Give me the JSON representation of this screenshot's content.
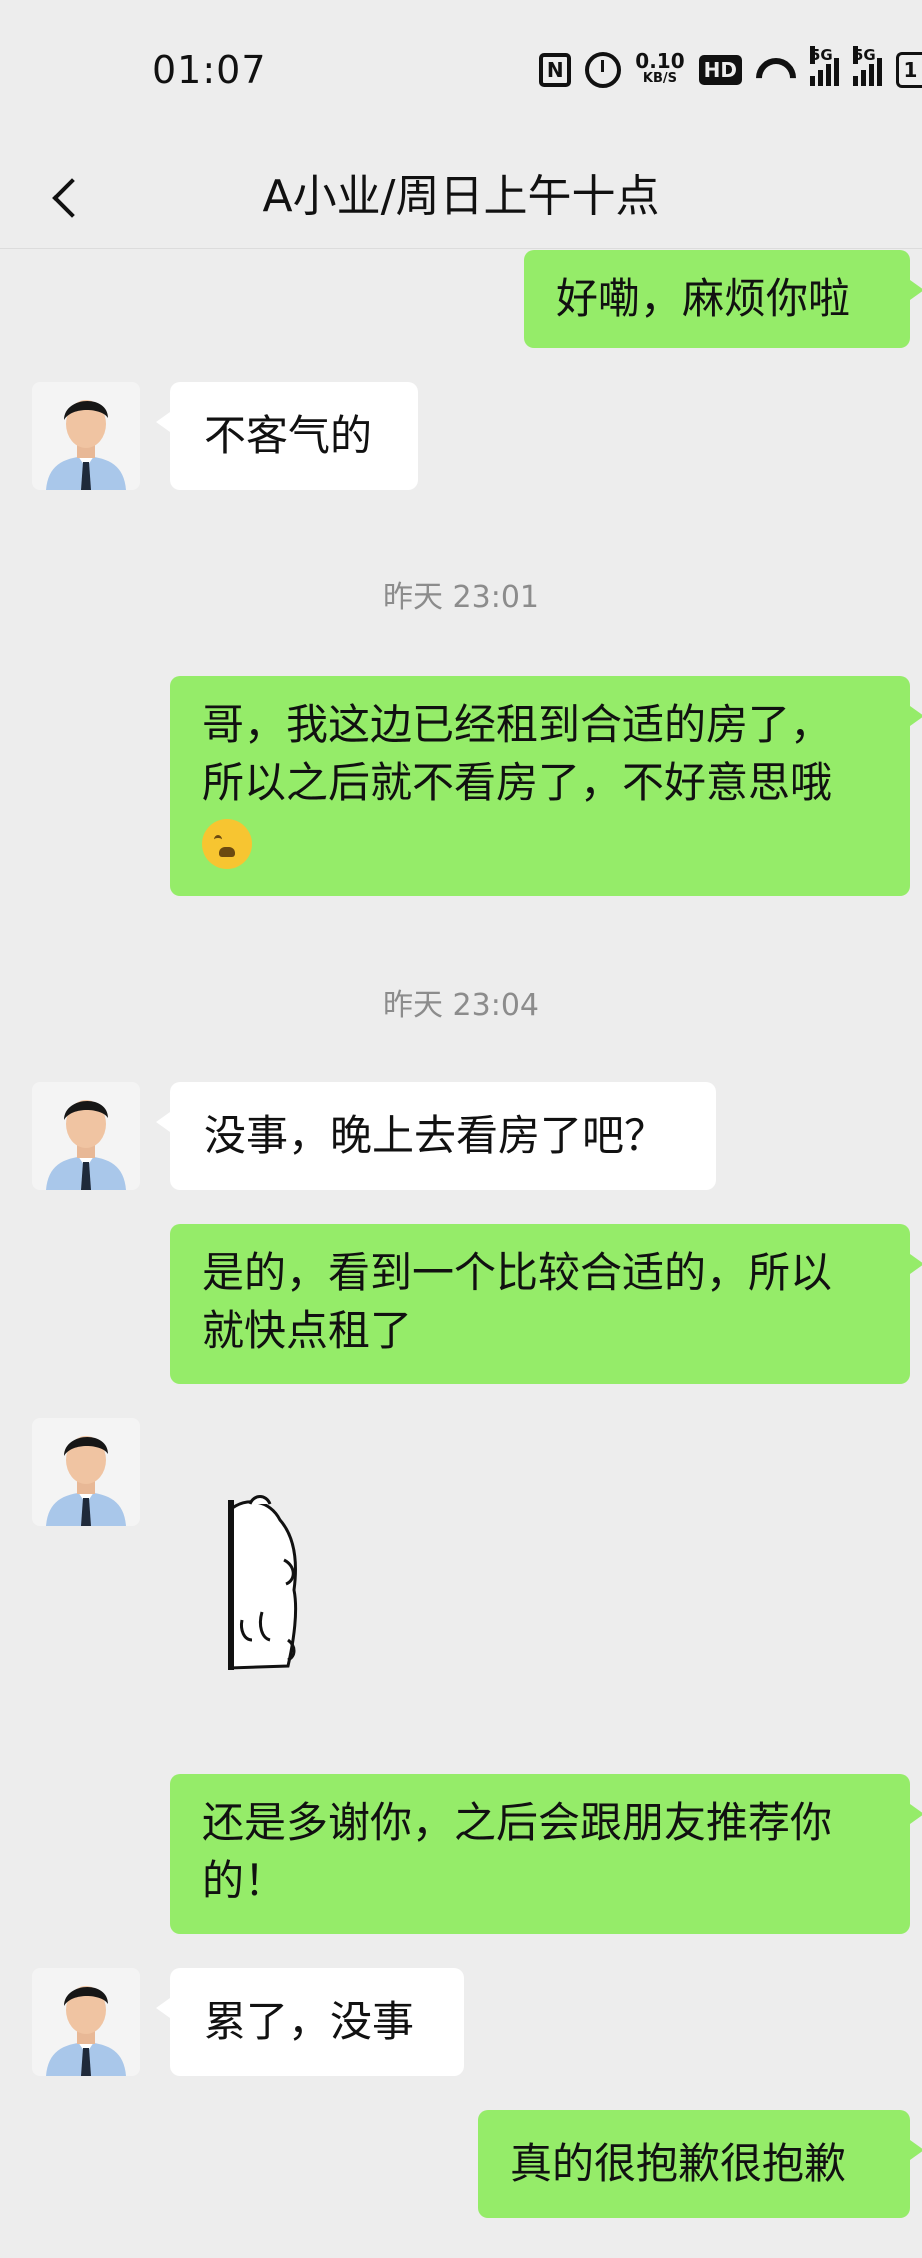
{
  "status_bar": {
    "time": "01:07",
    "nfc": "N",
    "net_speed_value": "0.10",
    "net_speed_unit": "KB/S",
    "hd": "HD",
    "signal1": "5G",
    "signal2": "5G",
    "battery": "1"
  },
  "header": {
    "title": "A小业/周日上午十点"
  },
  "messages": [
    {
      "side": "out",
      "text": "好嘞，麻烦你啦"
    },
    {
      "side": "in",
      "text": "不客气的"
    },
    {
      "side": "time",
      "text": "昨天 23:01"
    },
    {
      "side": "out",
      "line1": "哥，我这边已经租到合适的房了，",
      "line2": "所以之后就不看房了，不好意思哦",
      "emoji": "crying-face"
    },
    {
      "side": "time",
      "text": "昨天 23:04"
    },
    {
      "side": "in",
      "text": "没事，晚上去看房了吧？"
    },
    {
      "side": "out",
      "line1": "是的，看到一个比较合适的，所以",
      "line2": "就快点租了"
    },
    {
      "side": "in",
      "type": "sticker"
    },
    {
      "side": "out",
      "line1": "还是多谢你，之后会跟朋友推荐你",
      "line2": "的！"
    },
    {
      "side": "in",
      "text": "累了，没事"
    },
    {
      "side": "out",
      "text": "真的很抱歉很抱歉"
    }
  ],
  "colors": {
    "background": "#ededed",
    "outgoing_bubble": "#95ec69",
    "incoming_bubble": "#ffffff",
    "timestamp": "#8c8c8c"
  }
}
